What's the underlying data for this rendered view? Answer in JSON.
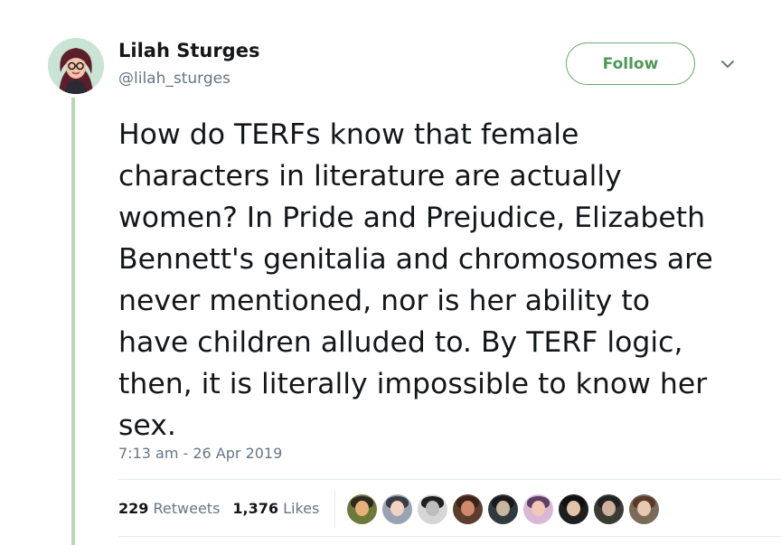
{
  "tweet": {
    "author_name": "Lilah Sturges",
    "author_handle": "@lilah_sturges",
    "follow_label": "Follow",
    "text": "How do TERFs know that female\ncharacters in literature are actually\nwomen? In Pride and Prejudice, Elizabeth\nBennett's genitalia and chromosomes are\nnever mentioned, nor is her ability to\nhave children alluded to. By TERF logic,\nthen, it is literally impossible to know her\nsex.",
    "timestamp": "7:13 am - 26 Apr 2019",
    "retweets_count": "229",
    "retweets_label": "Retweets",
    "likes_count": "1,376",
    "likes_label": "Likes"
  },
  "colors": {
    "thread_line": "#b9d7b7",
    "follow_accent": "#4b9a55",
    "secondary_text": "#657786"
  },
  "icons": {
    "menu": "chevron-down-icon"
  },
  "liker_avatars": [
    {
      "bg": "#6b7a3a",
      "face": "#e7b07a",
      "hair": "#2d2a1f"
    },
    {
      "bg": "#9aa3b4",
      "face": "#f1d3c2",
      "hair": "#3b3b45"
    },
    {
      "bg": "#d6d6d6",
      "face": "#bdbdbd",
      "hair": "#202020"
    },
    {
      "bg": "#5c3d2e",
      "face": "#d08a6a",
      "hair": "#3a2418"
    },
    {
      "bg": "#2f3b3f",
      "face": "#c8b6a0",
      "hair": "#1a1a1a"
    },
    {
      "bg": "#d8b8d6",
      "face": "#f2c9b4",
      "hair": "#5e3f66"
    },
    {
      "bg": "#1f1f1f",
      "face": "#e2c2a8",
      "hair": "#101010"
    },
    {
      "bg": "#3b3b35",
      "face": "#cdb19a",
      "hair": "#222222"
    },
    {
      "bg": "#7a6a5a",
      "face": "#e9c9ad",
      "hair": "#5a3a2a"
    }
  ]
}
